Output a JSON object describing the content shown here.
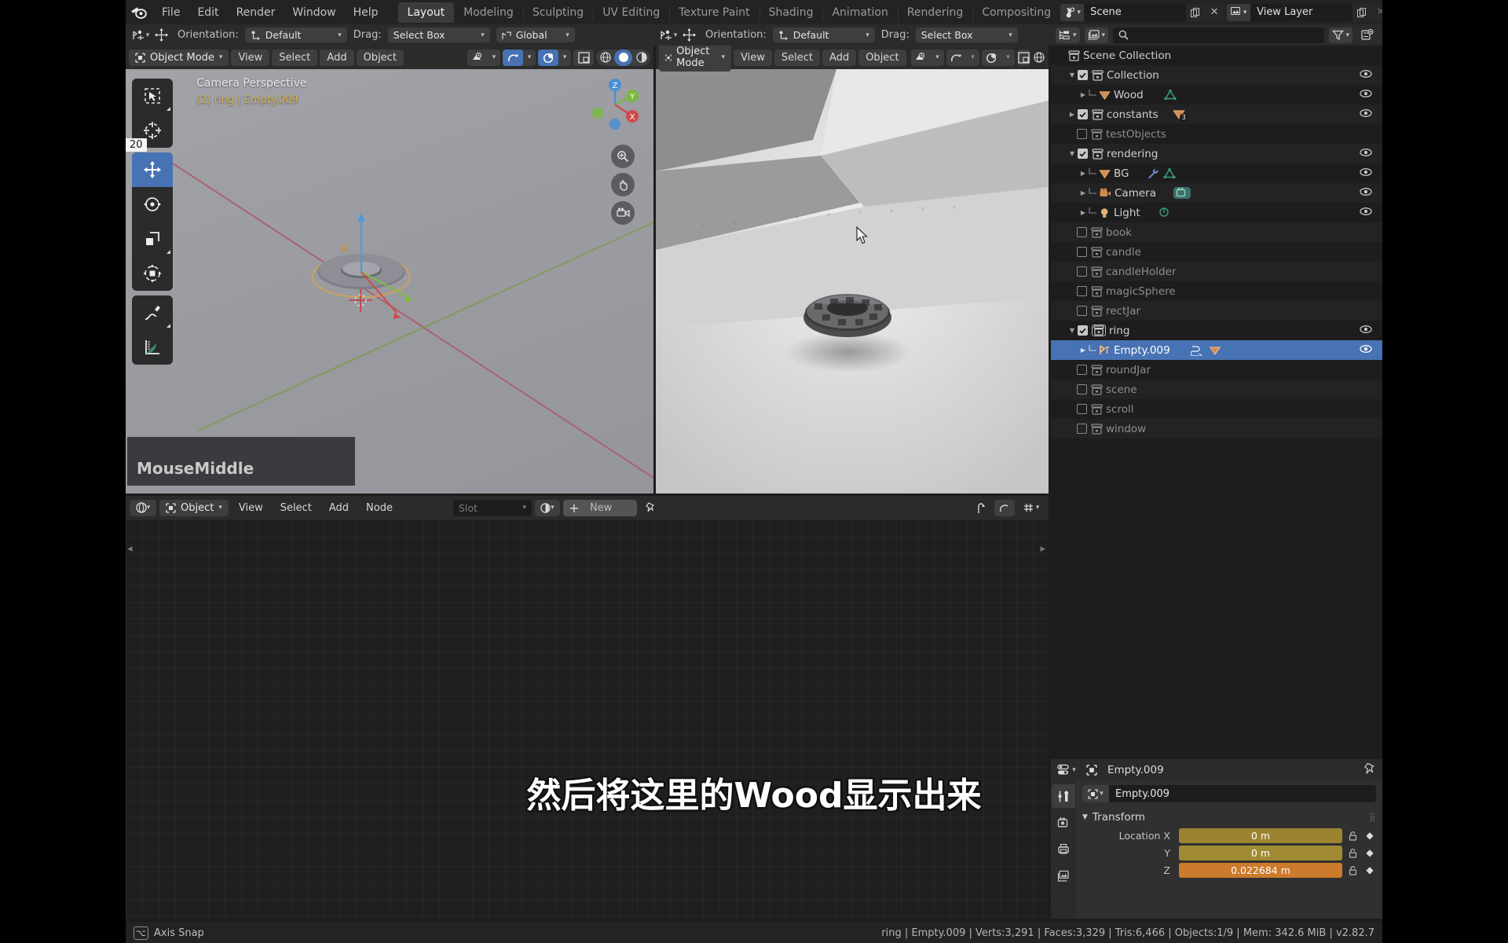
{
  "app": {
    "name": "Blender",
    "version_label": "v2.82.7"
  },
  "topbar": {
    "logo": "blender-logo",
    "menus": [
      "File",
      "Edit",
      "Render",
      "Window",
      "Help"
    ],
    "workspace_tabs": [
      {
        "label": "Layout",
        "active": true
      },
      {
        "label": "Modeling",
        "active": false
      },
      {
        "label": "Sculpting",
        "active": false
      },
      {
        "label": "UV Editing",
        "active": false
      },
      {
        "label": "Texture Paint",
        "active": false
      },
      {
        "label": "Shading",
        "active": false
      },
      {
        "label": "Animation",
        "active": false
      },
      {
        "label": "Rendering",
        "active": false
      },
      {
        "label": "Compositing",
        "active": false
      }
    ],
    "scene": {
      "icon": "scene-icon",
      "name": "Scene",
      "new_btn": "copy-icon",
      "unlink_btn": "x-icon"
    },
    "view_layer": {
      "icon": "view-layer-icon",
      "name": "View Layer",
      "new_btn": "copy-icon",
      "unlink_btn": "x-icon"
    }
  },
  "tool_settings": {
    "left": {
      "active_tool_icon": "move-tool-icon",
      "transform_icon": "transform-icon",
      "orientation_label": "Orientation:",
      "orientation_value": "Default",
      "drag_label": "Drag:",
      "drag_value": "Select Box",
      "snap_value": "Global"
    },
    "right": {
      "active_tool_icon": "move-tool-icon",
      "transform_icon": "transform-icon",
      "orientation_label": "Orientation:",
      "orientation_value": "Default",
      "drag_label": "Drag:",
      "drag_value": "Select Box"
    }
  },
  "viewport_left": {
    "header": {
      "mode": "Object Mode",
      "menus": [
        "View",
        "Select",
        "Add",
        "Object"
      ],
      "overlay_icons": [
        "visibility-icon",
        "snap-magnet-icon",
        "proportional-edit-icon",
        "gizmo-icon"
      ],
      "shading_modes": [
        "wireframe-shading-icon",
        "solid-shading-icon",
        "material-shading-icon"
      ]
    },
    "overlay_title": "Camera Perspective",
    "overlay_sub": "(2) ring | Empty.009",
    "zoom_badge": "20",
    "toolbar": [
      {
        "name": "select-box-tool",
        "group": 0,
        "selected": false
      },
      {
        "name": "cursor-tool",
        "group": 0,
        "selected": false
      },
      {
        "name": "move-tool",
        "group": 1,
        "selected": true
      },
      {
        "name": "rotate-tool",
        "group": 1,
        "selected": false
      },
      {
        "name": "scale-tool",
        "group": 1,
        "selected": false
      },
      {
        "name": "transform-tool",
        "group": 1,
        "selected": false
      },
      {
        "name": "annotate-tool",
        "group": 2,
        "selected": false
      },
      {
        "name": "measure-tool",
        "group": 2,
        "selected": false
      }
    ],
    "gizmo_axes": [
      "X",
      "Y",
      "Z"
    ],
    "nav_buttons": [
      "zoom-icon",
      "pan-hand-icon",
      "camera-view-icon"
    ],
    "status_overlay": "MouseMiddle"
  },
  "viewport_right": {
    "header": {
      "mode": "Object Mode",
      "menus": [
        "View",
        "Select",
        "Add",
        "Object"
      ]
    }
  },
  "shader_editor": {
    "editor_type_icon": "shader-editor-icon",
    "shader_type": "Object",
    "menus": [
      "View",
      "Select",
      "Add",
      "Node"
    ],
    "slot_placeholder": "Slot",
    "material_icon": "material-icon",
    "new_label": "New",
    "pin_icon": "pin-icon",
    "right_icons": [
      "go-to-parent-icon",
      "snap-node-icon",
      "overlays-icon"
    ]
  },
  "outliner": {
    "header": {
      "display_mode_icon": "outliner-display-mode-icon",
      "view_layer_icon": "view-layer-icon",
      "search_placeholder": "",
      "search_icon": "search-icon",
      "filter_icon": "filter-icon",
      "new_collection_icon": "new-collection-icon"
    },
    "rows": [
      {
        "label": "Scene Collection",
        "indent": 0,
        "icon": "collection-icon",
        "tri": "",
        "checkbox": null,
        "eye": false,
        "dim": false,
        "selected": false,
        "badges": []
      },
      {
        "label": "Collection",
        "indent": 1,
        "icon": "collection-icon",
        "tri": "down",
        "checkbox": true,
        "eye": true,
        "dim": false,
        "selected": false,
        "badges": []
      },
      {
        "label": "Wood",
        "indent": 2,
        "icon": "mesh-object-icon",
        "tri": "right",
        "checkbox": null,
        "eye": true,
        "dim": false,
        "selected": false,
        "badges": [
          "mesh-data-icon"
        ]
      },
      {
        "label": "constants",
        "indent": 1,
        "icon": "collection-icon",
        "tri": "right",
        "checkbox": true,
        "eye": true,
        "dim": false,
        "selected": false,
        "badges": [
          "mesh-object-icon-3"
        ]
      },
      {
        "label": "testObjects",
        "indent": 1,
        "icon": "collection-icon",
        "tri": "",
        "checkbox": false,
        "eye": false,
        "dim": true,
        "selected": false,
        "badges": []
      },
      {
        "label": "rendering",
        "indent": 1,
        "icon": "collection-icon",
        "tri": "down",
        "checkbox": true,
        "eye": true,
        "dim": false,
        "selected": false,
        "badges": []
      },
      {
        "label": "BG",
        "indent": 2,
        "icon": "mesh-object-icon",
        "tri": "right",
        "checkbox": null,
        "eye": true,
        "dim": false,
        "selected": false,
        "badges": [
          "modifier-wrench-icon",
          "mesh-data-icon"
        ]
      },
      {
        "label": "Camera",
        "indent": 2,
        "icon": "camera-object-icon",
        "tri": "right",
        "checkbox": null,
        "eye": true,
        "dim": false,
        "selected": false,
        "badges": [
          "camera-data-icon"
        ]
      },
      {
        "label": "Light",
        "indent": 2,
        "icon": "light-object-icon",
        "tri": "right",
        "checkbox": null,
        "eye": true,
        "dim": false,
        "selected": false,
        "badges": [
          "light-data-icon"
        ]
      },
      {
        "label": "book",
        "indent": 1,
        "icon": "collection-icon",
        "tri": "",
        "checkbox": false,
        "eye": false,
        "dim": true,
        "selected": false,
        "badges": []
      },
      {
        "label": "candle",
        "indent": 1,
        "icon": "collection-icon",
        "tri": "",
        "checkbox": false,
        "eye": false,
        "dim": true,
        "selected": false,
        "badges": []
      },
      {
        "label": "candleHolder",
        "indent": 1,
        "icon": "collection-icon",
        "tri": "",
        "checkbox": false,
        "eye": false,
        "dim": true,
        "selected": false,
        "badges": []
      },
      {
        "label": "magicSphere",
        "indent": 1,
        "icon": "collection-icon",
        "tri": "",
        "checkbox": false,
        "eye": false,
        "dim": true,
        "selected": false,
        "badges": []
      },
      {
        "label": "rectJar",
        "indent": 1,
        "icon": "collection-icon",
        "tri": "",
        "checkbox": false,
        "eye": false,
        "dim": true,
        "selected": false,
        "badges": []
      },
      {
        "label": "ring",
        "indent": 1,
        "icon": "collection-icon",
        "tri": "down",
        "checkbox": true,
        "eye": true,
        "dim": false,
        "selected": false,
        "badges": []
      },
      {
        "label": "Empty.009",
        "indent": 2,
        "icon": "empty-axis-icon",
        "tri": "right",
        "checkbox": null,
        "eye": true,
        "dim": false,
        "selected": true,
        "badges": [
          "constraint-icon",
          "mesh-object-icon"
        ]
      },
      {
        "label": "roundJar",
        "indent": 1,
        "icon": "collection-icon",
        "tri": "",
        "checkbox": false,
        "eye": false,
        "dim": true,
        "selected": false,
        "badges": []
      },
      {
        "label": "scene",
        "indent": 1,
        "icon": "collection-icon",
        "tri": "",
        "checkbox": false,
        "eye": false,
        "dim": true,
        "selected": false,
        "badges": []
      },
      {
        "label": "scroll",
        "indent": 1,
        "icon": "collection-icon",
        "tri": "",
        "checkbox": false,
        "eye": false,
        "dim": true,
        "selected": false,
        "badges": []
      },
      {
        "label": "window",
        "indent": 1,
        "icon": "collection-icon",
        "tri": "",
        "checkbox": false,
        "eye": false,
        "dim": true,
        "selected": false,
        "badges": []
      }
    ]
  },
  "properties": {
    "breadcrumb_icon": "object-properties-icon",
    "breadcrumb_title": "Empty.009",
    "pin_icon": "pin-icon",
    "tabs": [
      {
        "name": "tool-tab",
        "icon": "tool-icon",
        "active": true
      },
      {
        "name": "render-tab",
        "icon": "render-camera-icon",
        "active": false
      },
      {
        "name": "output-tab",
        "icon": "printer-icon",
        "active": false
      },
      {
        "name": "view-layer-tab",
        "icon": "images-icon",
        "active": false
      }
    ],
    "name_field": {
      "icon": "empty-object-icon",
      "value": "Empty.009"
    },
    "transform_panel": {
      "title": "Transform",
      "expanded": true
    },
    "fields": [
      {
        "label": "Location X",
        "value": "0 m",
        "color": "#9b8330",
        "lock": "unlocked-icon",
        "key": "keyframe-icon"
      },
      {
        "label": "Y",
        "value": "0 m",
        "color": "#a08b33",
        "lock": "unlocked-icon",
        "key": "keyframe-icon"
      },
      {
        "label": "Z",
        "value": "0.022684 m",
        "color": "#cc7a2b",
        "lock": "unlocked-icon",
        "key": "keyframe-icon"
      }
    ]
  },
  "statusbar": {
    "key_hint_icon": "alt-key-icon",
    "key_hint_label": "Axis Snap",
    "stats": "ring | Empty.009 | Verts:3,291 | Faces:3,329 | Tris:6,466 | Objects:1/9 | Mem: 342.6 MiB | v2.82.7"
  },
  "subtitle": {
    "text": "然后将这里的Wood显示出来"
  },
  "colors": {
    "accent_blue": "#4772b3",
    "header_bg": "#2b2b2b",
    "editor_bg": "#1d1d1d",
    "topbar_bg": "#232323",
    "orange": "#cc7a2b",
    "olive": "#9b8330"
  }
}
